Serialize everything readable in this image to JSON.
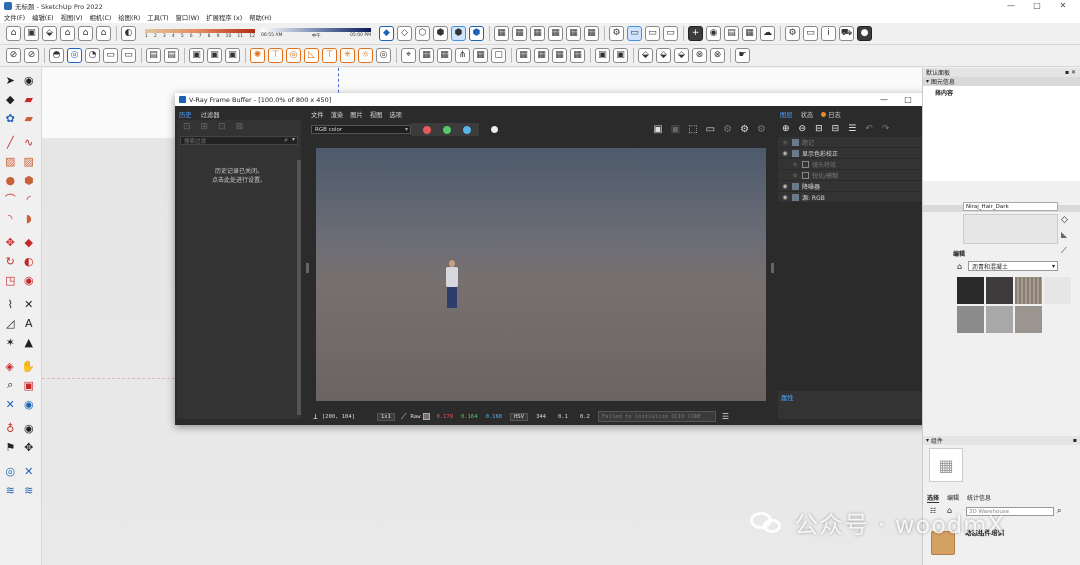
{
  "app": {
    "title": "无标题 - SketchUp Pro 2022",
    "window_controls": [
      "—",
      "□",
      "✕"
    ]
  },
  "menubar": [
    "文件(F)",
    "编辑(E)",
    "视图(V)",
    "相机(C)",
    "绘图(R)",
    "工具(T)",
    "窗口(W)",
    "扩展程序 (x)",
    "帮助(H)"
  ],
  "toolbar": {
    "shadow_scale_nums": [
      "1",
      "2",
      "3",
      "4",
      "5",
      "6",
      "7",
      "8",
      "9",
      "10",
      "11",
      "12"
    ],
    "time_scale_nums": [
      "06:55 AM",
      "中午",
      "05:00 PM"
    ]
  },
  "vfb": {
    "title": "V-Ray Frame Buffer - [100.0% of 800 x 450]",
    "window_controls": [
      "—",
      "□",
      "✕"
    ],
    "left_tabs": [
      "历史",
      "过滤器"
    ],
    "history_search_placeholder": "搜索过滤",
    "history_message": [
      "历史记录已关闭。",
      "点击此处进行设置。"
    ],
    "menu": [
      "文件",
      "渲染",
      "图片",
      "视图",
      "选项"
    ],
    "channel": "RGB color",
    "layer_tabs": [
      "图层",
      "状态",
      "日志"
    ],
    "layers": [
      {
        "name": "题记",
        "visible": false,
        "dim": true,
        "indent": false
      },
      {
        "name": "显示色彩校正",
        "visible": true,
        "dim": false,
        "indent": false
      },
      {
        "name": "镜头特效",
        "visible": false,
        "dim": true,
        "indent": true
      },
      {
        "name": "锐化/模糊",
        "visible": false,
        "dim": true,
        "indent": true
      },
      {
        "name": "降噪器",
        "visible": true,
        "dim": false,
        "indent": false
      },
      {
        "name": "源: RGB",
        "visible": true,
        "dim": false,
        "indent": false
      }
    ],
    "properties_label": "属性",
    "status": {
      "coords": "[200, 104]",
      "zoom": "1x1",
      "mode": "Raw",
      "r": "0.179",
      "g": "0.164",
      "b": "0.168",
      "colorspace": "HSV",
      "h": "344",
      "s": "0.1",
      "v": "0.2",
      "ocio": "Failed to initialize OCIO CORE"
    }
  },
  "right_dock": {
    "default_panel": "默认面板",
    "entity_info": "图元信息",
    "entity_sub": "择内容",
    "material_name": "Niraj_Hair_Dark",
    "edit_label": "编辑",
    "material_library": "沥青和混凝土",
    "components_head": "组件",
    "comp_tabs": [
      "选择",
      "编辑",
      "统计信息"
    ],
    "warehouse_placeholder": "3D Warehouse",
    "dynamic_title": "动态组件培训"
  },
  "watermark": "公众号 · woodmX",
  "colors": {
    "accent_blue": "#4fa3ff",
    "vfb_bg": "#2b2b2b",
    "r_text": "#e85a5a",
    "g_text": "#55c86a",
    "b_text": "#5ab6ea"
  }
}
